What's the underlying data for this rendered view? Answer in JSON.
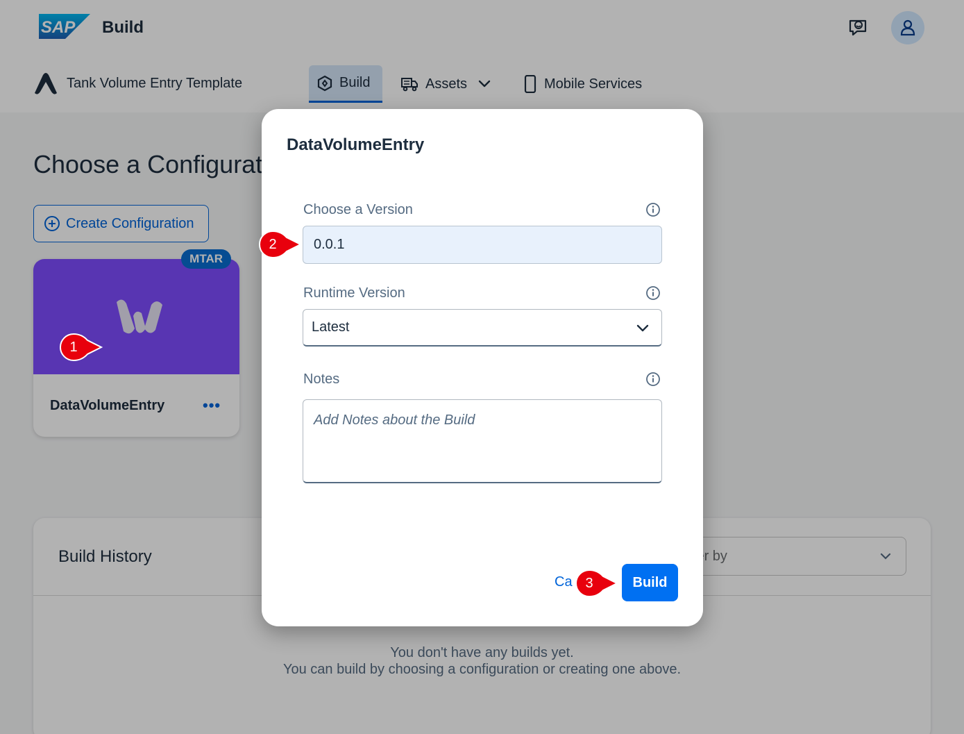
{
  "shell": {
    "title": "Build",
    "icons": {
      "feedback": "feedback-icon",
      "avatar": "user-avatar-icon"
    }
  },
  "nav": {
    "app_name": "Tank Volume Entry Template",
    "tabs": [
      {
        "label": "Build",
        "icon": "build-icon",
        "active": true
      },
      {
        "label": "Assets",
        "icon": "assets-icon",
        "has_dropdown": true
      },
      {
        "label": "Mobile Services",
        "icon": "mobile-icon"
      }
    ]
  },
  "page": {
    "title": "Choose a Configurati",
    "create_button": "Create Configuration"
  },
  "config_card": {
    "badge": "MTAR",
    "name": "DataVolumeEntry",
    "more": "•••",
    "banner_color": "#7e4cff"
  },
  "history": {
    "title": "Build History",
    "filter_placeholder": "ilter by",
    "empty_line1": "You don't have any builds yet.",
    "empty_line2": "You can build by choosing a configuration or creating one above."
  },
  "dialog": {
    "title": "DataVolumeEntry",
    "version_label": "Choose a Version",
    "version_value": "0.0.1",
    "runtime_label": "Runtime Version",
    "runtime_value": "Latest",
    "notes_label": "Notes",
    "notes_placeholder": "Add Notes about the Build",
    "cancel_label": "Ca",
    "build_label": "Build"
  },
  "callouts": [
    "1",
    "2",
    "3"
  ],
  "colors": {
    "accent": "#0064d9",
    "primary_button": "#0070f2",
    "callout": "#e8000d"
  }
}
